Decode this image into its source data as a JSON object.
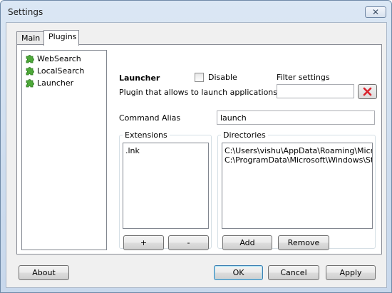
{
  "window": {
    "title": "Settings",
    "close_glyph": "✕"
  },
  "tabs": [
    {
      "label": "Main"
    },
    {
      "label": "Plugins"
    }
  ],
  "plugins": [
    {
      "label": "WebSearch",
      "icon": "puzzle-piece-icon"
    },
    {
      "label": "LocalSearch",
      "icon": "puzzle-piece-icon"
    },
    {
      "label": "Launcher",
      "icon": "puzzle-piece-icon",
      "selected": true
    }
  ],
  "plugin_detail": {
    "name": "Launcher",
    "disable_label": "Disable",
    "disable_checked": false,
    "description": "Plugin that allows to launch applications",
    "filter_label": "Filter settings",
    "filter_value": "",
    "command_alias_label": "Command Alias",
    "command_alias_value": "launch"
  },
  "extensions": {
    "title": "Extensions",
    "items": [
      ".lnk"
    ],
    "add_label": "+",
    "remove_label": "-"
  },
  "directories": {
    "title": "Directories",
    "items": [
      "C:\\Users\\vishu\\AppData\\Roaming\\Microsof",
      "C:\\ProgramData\\Microsoft\\Windows\\Start M"
    ],
    "add_label": "Add",
    "remove_label": "Remove"
  },
  "footer": {
    "about_label": "About",
    "ok_label": "OK",
    "cancel_label": "Cancel",
    "apply_label": "Apply"
  },
  "colors": {
    "clear_filter_x": "#d9232d",
    "puzzle_green": "#4ea93a"
  }
}
